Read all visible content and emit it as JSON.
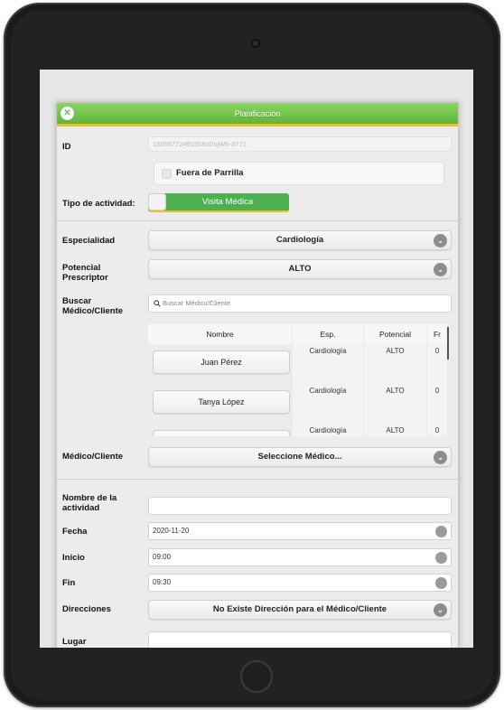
{
  "header": {
    "title": "Planificación",
    "close_icon": "close-icon"
  },
  "labels": {
    "id": "ID",
    "tipo": "Tipo de actividad:",
    "especialidad": "Especialidad",
    "potencial_1": "Potencial",
    "potencial_2": "Prescriptor",
    "buscar_1": "Buscar",
    "buscar_2": "Médico/Cliente",
    "medico": "Médico/Cliente",
    "nombre_1": "Nombre de la",
    "nombre_2": "actividad",
    "fecha": "Fecha",
    "inicio": "Inicio",
    "fin": "Fin",
    "direcciones": "Direcciones",
    "lugar": "Lugar"
  },
  "fields": {
    "id_value": "16056772491558vDujWh-3771",
    "fuera_label": "Fuera de Parrilla",
    "fuera_checked": false,
    "tipo_value": "Visita Médica",
    "especialidad_value": "Cardiología",
    "potencial_value": "ALTO",
    "search_placeholder": "Buscar Médico/Cliente",
    "medico_value": "Seleccione Médico...",
    "nombre_value": "",
    "fecha_value": "2020-11-20",
    "inicio_value": "09:00",
    "fin_value": "09:30",
    "direcciones_value": "No Existe Dirección para el Médico/Cliente",
    "lugar_value": ""
  },
  "table": {
    "columns": [
      "Nombre",
      "Esp.",
      "Potencial",
      "Fr"
    ],
    "rows": [
      {
        "nombre": "Juan Pérez",
        "esp": "Cardiología",
        "potencial": "ALTO",
        "fr": "0"
      },
      {
        "nombre": "Tanya López",
        "esp": "Cardiología",
        "potencial": "ALTO",
        "fr": "0"
      },
      {
        "nombre": "",
        "esp": "Cardiología",
        "potencial": "ALTO",
        "fr": "0"
      }
    ]
  },
  "colors": {
    "header_green": "#6fbf45",
    "toggle_green": "#4caf50",
    "accent_yellow": "#e6c32c"
  }
}
